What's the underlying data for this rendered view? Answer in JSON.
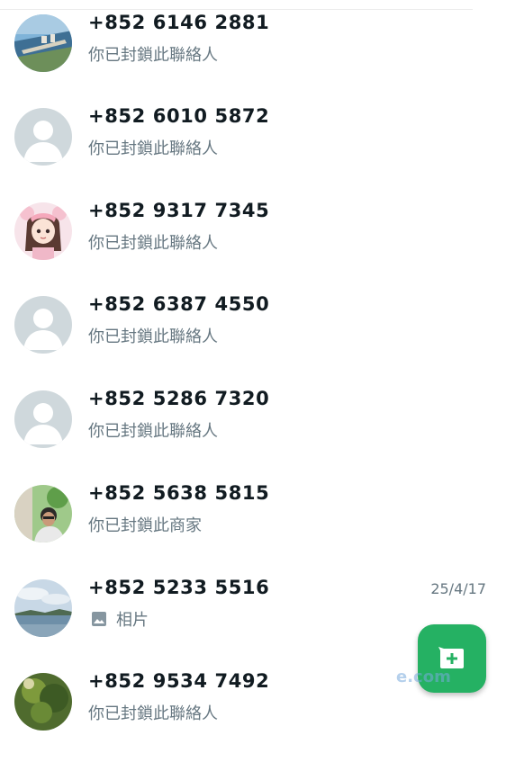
{
  "chats": [
    {
      "name": "+852 6146 2881",
      "preview": "你已封鎖此聯絡人",
      "avatar": "coastal-photo"
    },
    {
      "name": "+852 6010 5872",
      "preview": "你已封鎖此聯絡人",
      "avatar": "default"
    },
    {
      "name": "+852 9317 7345",
      "preview": "你已封鎖此聯絡人",
      "avatar": "anime-girl"
    },
    {
      "name": "+852 6387 4550",
      "preview": "你已封鎖此聯絡人",
      "avatar": "default"
    },
    {
      "name": "+852 5286 7320",
      "preview": "你已封鎖此聯絡人",
      "avatar": "default"
    },
    {
      "name": "+852 5638 5815",
      "preview": "你已封鎖此商家",
      "avatar": "person-photo"
    },
    {
      "name": "+852 5233 5516",
      "preview": "相片",
      "preview_icon": "image-icon",
      "timestamp": "25/4/17",
      "avatar": "seascape-photo"
    },
    {
      "name": "+852 9534 7492",
      "preview": "你已封鎖此聯絡人",
      "avatar": "nature-photo"
    }
  ],
  "fab": {
    "icon": "new-chat-icon"
  },
  "colors": {
    "accent": "#25b163",
    "name_text": "#111b21",
    "secondary_text": "#667781",
    "default_avatar_bg": "#cfd8dc"
  },
  "watermark": "e.com"
}
